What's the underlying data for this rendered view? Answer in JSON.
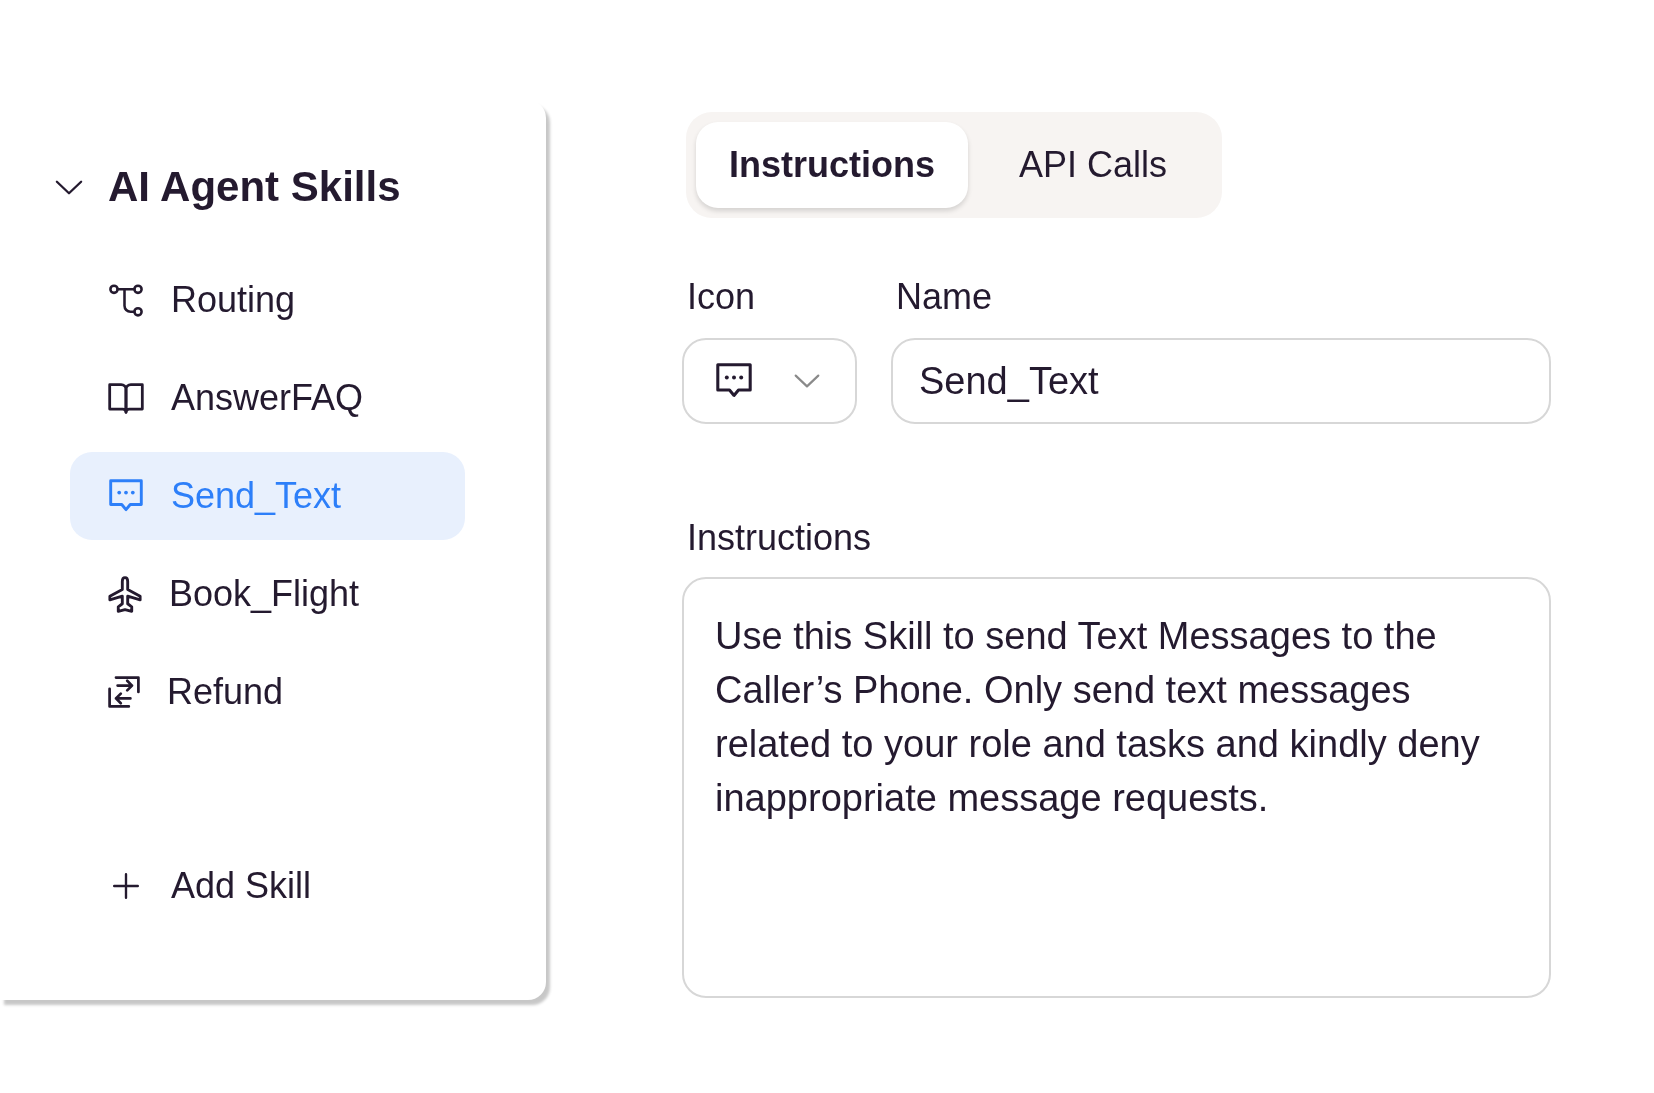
{
  "sidebar": {
    "title": "AI Agent Skills",
    "expanded": true,
    "items": [
      {
        "label": "Routing",
        "selected": false
      },
      {
        "label": "AnswerFAQ",
        "selected": false
      },
      {
        "label": "Send_Text",
        "selected": true
      },
      {
        "label": "Book_Flight",
        "selected": false
      },
      {
        "label": "Refund",
        "selected": false
      }
    ],
    "add_button": "Add Skill"
  },
  "tabs": [
    {
      "label": "Instructions",
      "selected": true
    },
    {
      "label": "API Calls",
      "selected": false
    }
  ],
  "form": {
    "icon_field": {
      "label": "Icon"
    },
    "name_field": {
      "label": "Name",
      "value": "Send_Text"
    },
    "instructions_field": {
      "label": "Instructions",
      "value": "Use this Skill to send Text Messages to the Caller’s Phone. Only send text messages related to your role and tasks and kindly deny inappropriate message requests."
    }
  }
}
